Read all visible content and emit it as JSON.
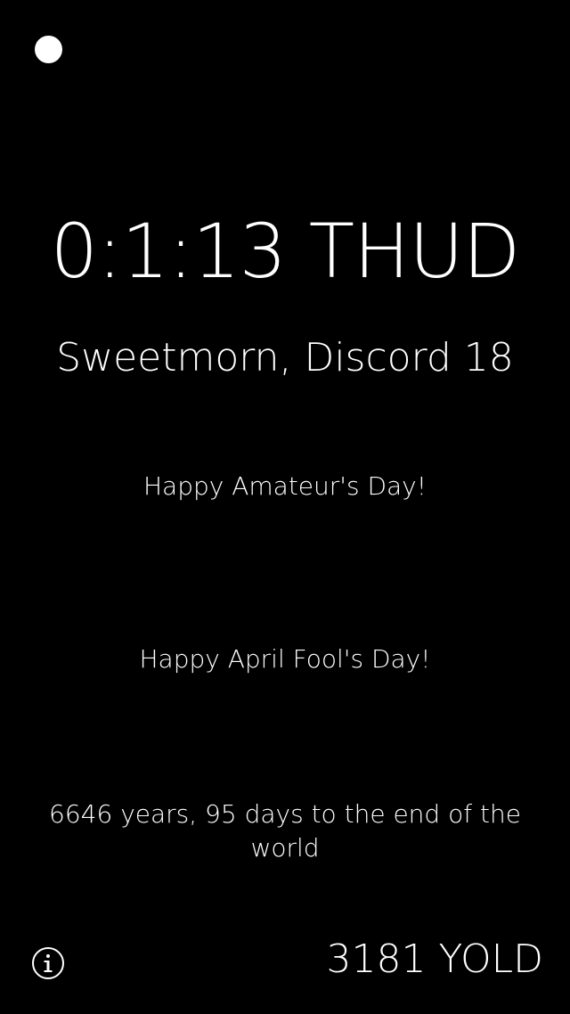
{
  "menu_dot_icon": "white-dot-icon",
  "clock": {
    "time": "0:1:13 THUD"
  },
  "date": {
    "text": "Sweetmorn, Discord 18"
  },
  "messages": [
    "Happy Amateur's Day!",
    "Happy April Fool's Day!"
  ],
  "countdown": {
    "text": "6646 years, 95 days to the end of the world"
  },
  "footer": {
    "info_icon": "info-icon",
    "year": "3181 YOLD"
  },
  "colors": {
    "background": "#000000",
    "foreground": "#ffffff"
  }
}
